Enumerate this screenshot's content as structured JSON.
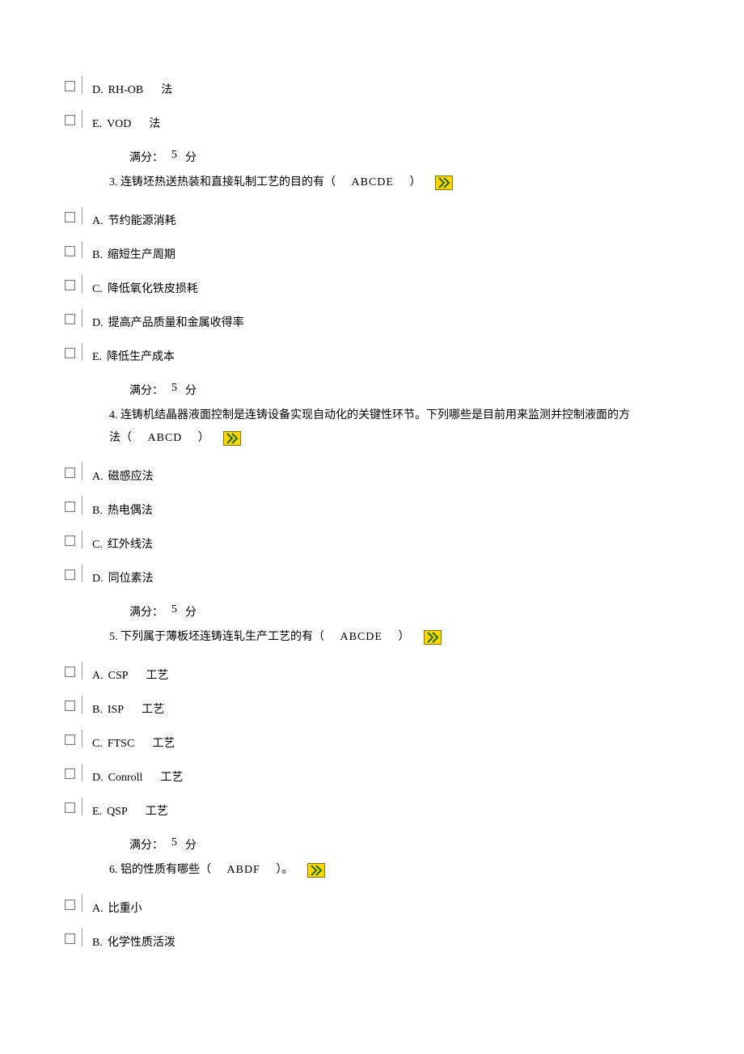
{
  "leading_options": [
    {
      "letter": "D.",
      "text": "RH-OB",
      "suffix": "法"
    },
    {
      "letter": "E.",
      "text": "VOD",
      "suffix": "法"
    }
  ],
  "score_label_prefix": "满分：",
  "score_value": "5",
  "score_label_suffix": "分",
  "questions": [
    {
      "number": "3.",
      "stem_prefix": "连铸坯热送热装和直接轧制工艺的目的有（",
      "answer": "ABCDE",
      "stem_suffix": "）",
      "options": [
        {
          "letter": "A.",
          "text": "节约能源消耗"
        },
        {
          "letter": "B.",
          "text": "缩短生产周期"
        },
        {
          "letter": "C.",
          "text": "降低氧化铁皮损耗"
        },
        {
          "letter": "D.",
          "text": "提高产品质量和金属收得率"
        },
        {
          "letter": "E.",
          "text": "降低生产成本"
        }
      ]
    },
    {
      "number": "4.",
      "stem_prefix": "连铸机结晶器液面控制是连铸设备实现自动化的关键性环节。下列哪些是目前用来监测并控制液面的方法（",
      "answer": "ABCD",
      "stem_suffix": "）",
      "options": [
        {
          "letter": "A.",
          "text": "磁感应法"
        },
        {
          "letter": "B.",
          "text": "热电偶法"
        },
        {
          "letter": "C.",
          "text": "红外线法"
        },
        {
          "letter": "D.",
          "text": "同位素法"
        }
      ]
    },
    {
      "number": "5.",
      "stem_prefix": "下列属于薄板坯连铸连轧生产工艺的有（",
      "answer": "ABCDE",
      "stem_suffix": "）",
      "options": [
        {
          "letter": "A.",
          "text": "CSP",
          "suffix": "工艺"
        },
        {
          "letter": "B.",
          "text": "ISP",
          "suffix": "工艺"
        },
        {
          "letter": "C.",
          "text": "FTSC",
          "suffix": "工艺"
        },
        {
          "letter": "D.",
          "text": "Conroll",
          "suffix": "工艺"
        },
        {
          "letter": "E.",
          "text": "QSP",
          "suffix": "工艺"
        }
      ]
    },
    {
      "number": "6.",
      "stem_prefix": "铝的性质有哪些（",
      "answer": "ABDF",
      "stem_suffix": "）。",
      "options": [
        {
          "letter": "A.",
          "text": "比重小"
        },
        {
          "letter": "B.",
          "text": "化学性质活泼"
        }
      ]
    }
  ]
}
